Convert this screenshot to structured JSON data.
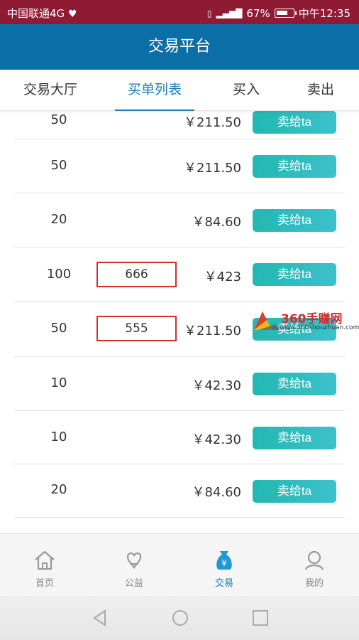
{
  "status_bar": {
    "carrier": "中国联通4G",
    "battery_percent": "67%",
    "time": "中午12:35"
  },
  "header": {
    "title": "交易平台"
  },
  "tabs": [
    {
      "label": "交易大厅",
      "active": false
    },
    {
      "label": "买单列表",
      "active": true
    },
    {
      "label": "买入",
      "active": false
    },
    {
      "label": "卖出",
      "active": false
    }
  ],
  "orders": [
    {
      "qty": "50",
      "note": "",
      "price": "￥211.50",
      "action": "卖给ta"
    },
    {
      "qty": "50",
      "note": "",
      "price": "￥211.50",
      "action": "卖给ta"
    },
    {
      "qty": "20",
      "note": "",
      "price": "￥84.60",
      "action": "卖给ta"
    },
    {
      "qty": "100",
      "note": "666",
      "price": "￥423",
      "action": "卖给ta"
    },
    {
      "qty": "50",
      "note": "555",
      "price": "￥211.50",
      "action": "卖给ta"
    },
    {
      "qty": "10",
      "note": "",
      "price": "￥42.30",
      "action": "卖给ta"
    },
    {
      "qty": "10",
      "note": "",
      "price": "￥42.30",
      "action": "卖给ta"
    },
    {
      "qty": "20",
      "note": "",
      "price": "￥84.60",
      "action": "卖给ta"
    }
  ],
  "watermark": {
    "title": "360手赚网",
    "url": "www.360shouzhuan.com"
  },
  "bottom_nav": [
    {
      "label": "首页",
      "icon": "home-icon",
      "active": false
    },
    {
      "label": "公益",
      "icon": "charity-icon",
      "active": false
    },
    {
      "label": "交易",
      "icon": "money-bag-icon",
      "active": true
    },
    {
      "label": "我的",
      "icon": "user-icon",
      "active": false
    }
  ],
  "colors": {
    "status_bar": "#8e1a33",
    "header": "#0c6ea6",
    "accent": "#1b7bb8",
    "sell_button": "#2bbcbc",
    "note_border": "#d0312d"
  }
}
